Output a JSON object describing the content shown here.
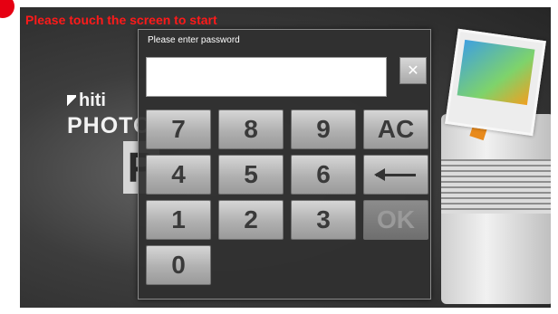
{
  "prompt": "Please touch the screen to start",
  "brand": {
    "mark": "hiti",
    "product_partial": "PHOTO",
    "letter_partial": "P"
  },
  "dialog": {
    "title": "Please enter password",
    "password_value": "",
    "clear_icon": "close-icon",
    "keys": {
      "k7": "7",
      "k8": "8",
      "k9": "9",
      "ac": "AC",
      "k4": "4",
      "k5": "5",
      "k6": "6",
      "backspace_icon": "left-arrow-icon",
      "k1": "1",
      "k2": "2",
      "k3": "3",
      "ok": "OK",
      "k0": "0"
    }
  },
  "colors": {
    "prompt": "#ff1a1a",
    "accent_red": "#e60012",
    "printer_stand": "#e88a1c"
  }
}
